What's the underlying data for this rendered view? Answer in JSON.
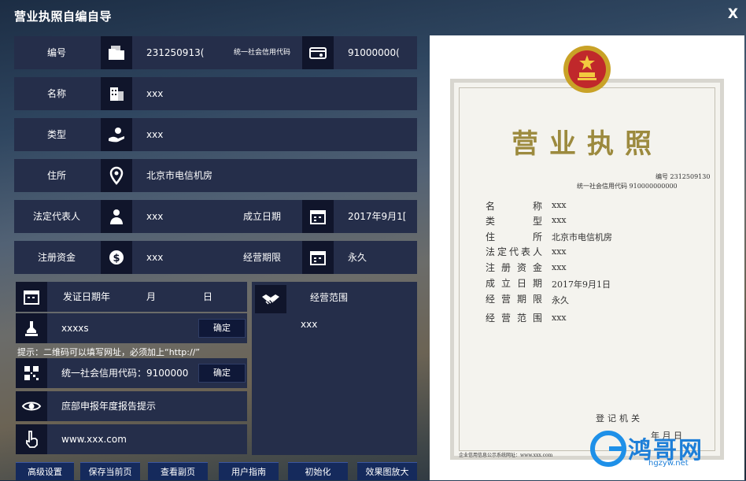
{
  "window": {
    "title": "营业执照自编自导",
    "close_label": "X"
  },
  "form": {
    "number_label": "编号",
    "number_value": "231250913(",
    "credit_code_label": "统一社会信用代码",
    "credit_code_value": "91000000(",
    "name_label": "名称",
    "name_value": "xxx",
    "type_label": "类型",
    "type_value": "xxx",
    "address_label": "住所",
    "address_value": "北京市电信机房",
    "legal_rep_label": "法定代表人",
    "legal_rep_value": "xxx",
    "established_label": "成立日期",
    "established_value": "2017年9月1[",
    "capital_label": "注册资金",
    "capital_value": "xxx",
    "term_label": "经营期限",
    "term_value": "永久"
  },
  "issue": {
    "label": "发证日期年",
    "month_label": "月",
    "day_label": "日"
  },
  "scope": {
    "label": "经营范围",
    "value": "xxx"
  },
  "seal": {
    "value": "xxxxs",
    "confirm_label": "确定"
  },
  "hint": "提示：二维码可以填写网址，必须加上“http://”",
  "qr": {
    "value": "统一社会信用代码：9100000",
    "confirm_label": "确定"
  },
  "notice": {
    "text": "庶部申报年度报告提示"
  },
  "website": {
    "value": "www.xxx.com"
  },
  "buttons": [
    "高级设置",
    "保存当前页",
    "查看副页",
    "用户指南",
    "初始化",
    "效果图放大"
  ],
  "certificate": {
    "title": "营业执照",
    "serial": "编号 2312509130",
    "credit": "统一社会信用代码 910000000000",
    "fields": [
      {
        "label": "名称",
        "value": "xxx"
      },
      {
        "label": "类型",
        "value": "xxx"
      },
      {
        "label": "住所",
        "value": "北京市电信机房"
      },
      {
        "label": "法定代表人",
        "value": "xxx"
      },
      {
        "label": "注册资金",
        "value": "xxx"
      },
      {
        "label": "成立日期",
        "value": "2017年9月1日"
      },
      {
        "label": "经营期限",
        "value": "永久"
      },
      {
        "label": "经营范围",
        "value": "xxx"
      }
    ],
    "authority": "登记机关",
    "date_tail": "年    月    日",
    "footer": "企业信用信息公示系统网址：www.xxx.com"
  },
  "watermark": {
    "brand": "鸿哥网",
    "url": "hgzyw.net"
  },
  "colors": {
    "cert_title": "#9c8a3e",
    "panel": "#252e4a",
    "icon_box": "#10152b",
    "button": "#152a5c"
  }
}
